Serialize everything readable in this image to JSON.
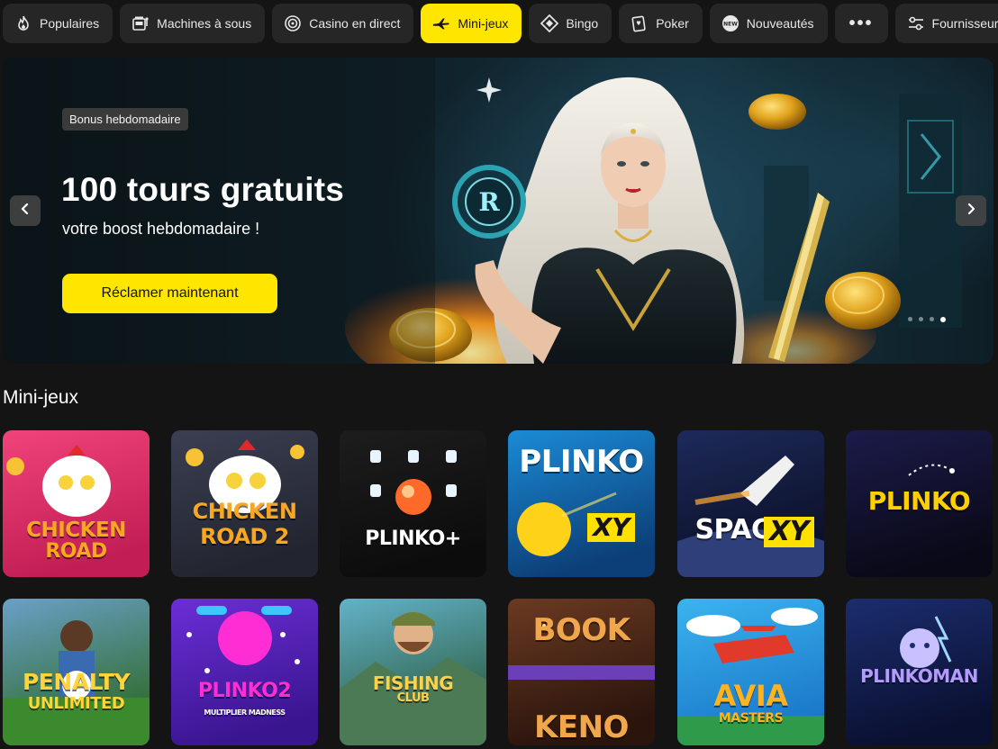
{
  "nav": {
    "items": [
      {
        "label": "Populaires",
        "icon": "flame-icon",
        "active": false
      },
      {
        "label": "Machines à sous",
        "icon": "slot-machine-icon",
        "active": false
      },
      {
        "label": "Casino en direct",
        "icon": "roulette-icon",
        "active": false
      },
      {
        "label": "Mini-jeux",
        "icon": "plane-icon",
        "active": true
      },
      {
        "label": "Bingo",
        "icon": "diamond-icon",
        "active": false
      },
      {
        "label": "Poker",
        "icon": "cards-icon",
        "active": false
      },
      {
        "label": "Nouveautés",
        "icon": "new-badge-icon",
        "active": false
      },
      {
        "label": "•••",
        "icon": "more-icon",
        "active": false
      },
      {
        "label": "Fournisseurs",
        "icon": "filter-sliders-icon",
        "active": false
      }
    ],
    "new_badge_text": "NEW"
  },
  "banner": {
    "tag": "Bonus hebdomadaire",
    "title": "100 tours gratuits",
    "subtitle": "votre boost hebdomadaire !",
    "cta": "Réclamer maintenant",
    "coin_letter": "R",
    "slides": 4,
    "active_slide": 4
  },
  "section": {
    "title": "Mini-jeux"
  },
  "games": [
    {
      "title": "CHICKEN ROAD",
      "line1": "CHICKEN",
      "line2": "ROAD",
      "bg1": "#f0437a",
      "bg2": "#c21e55",
      "accent": "#f7a823"
    },
    {
      "title": "CHICKEN ROAD 2",
      "line1": "CHICKEN",
      "line2": "ROAD 2",
      "bg1": "#3b3f52",
      "bg2": "#22242f",
      "accent": "#f7a823"
    },
    {
      "title": "PLINKO+",
      "line1": "PLINKO+",
      "line2": "",
      "bg1": "#1d1d1d",
      "bg2": "#0c0c0c",
      "accent": "#ffffff"
    },
    {
      "title": "PLINKO XY",
      "line1": "PLINKO",
      "line2": "XY",
      "bg1": "#1b8bd6",
      "bg2": "#0c3f78",
      "accent": "#ffe100"
    },
    {
      "title": "SPACE XY",
      "line1": "SPACE",
      "line2": "XY",
      "bg1": "#1d2a5a",
      "bg2": "#0b0f26",
      "accent": "#ffe100"
    },
    {
      "title": "PLINKO",
      "line1": "PLINKO",
      "line2": "",
      "bg1": "#1c1b4a",
      "bg2": "#090917",
      "accent": "#ffd000"
    },
    {
      "title": "PENALTY UNLIMITED",
      "line1": "PENALTY",
      "line2": "UNLIMITED",
      "bg1": "#6aa0c8",
      "bg2": "#2e6b2a",
      "accent": "#ffd43a"
    },
    {
      "title": "PLINKO 2",
      "line1": "PLINKO2",
      "line2": "MULTIPLIER MADNESS",
      "bg1": "#6b2ed6",
      "bg2": "#3a1590",
      "accent": "#ff2dd4"
    },
    {
      "title": "FISHING CLUB",
      "line1": "FISHING",
      "line2": "CLUB",
      "bg1": "#63b2c9",
      "bg2": "#2b5a3d",
      "accent": "#ffd14a"
    },
    {
      "title": "BOOK OF KENO",
      "line1": "BOOK",
      "line2": "KENO",
      "bg1": "#6b3a22",
      "bg2": "#2a140c",
      "accent": "#f0a64a"
    },
    {
      "title": "AVIA MASTERS",
      "line1": "AVIA",
      "line2": "MASTERS",
      "bg1": "#3bb4ef",
      "bg2": "#1a78c9",
      "accent": "#ffb41f"
    },
    {
      "title": "PLINKO MAN",
      "line1": "PLINKOMAN",
      "line2": "",
      "bg1": "#1b2d6e",
      "bg2": "#0a1030",
      "accent": "#b49cff"
    }
  ],
  "colors": {
    "accent": "#ffe600",
    "background": "#141414",
    "nav_bg": "#262626"
  }
}
